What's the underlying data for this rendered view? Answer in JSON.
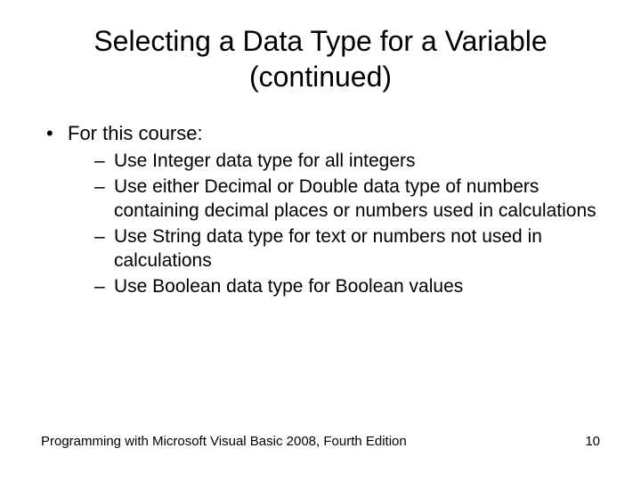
{
  "title_line1": "Selecting a Data Type for a Variable",
  "title_line2": "(continued)",
  "bullets": {
    "main": "For this course:",
    "sub": [
      "Use Integer data type for all integers",
      "Use either Decimal or Double data type of numbers containing decimal places or numbers used in calculations",
      "Use String data type for text or numbers not used in calculations",
      "Use Boolean data type for Boolean values"
    ]
  },
  "footer": {
    "book": "Programming with Microsoft Visual Basic 2008, Fourth Edition",
    "page": "10"
  }
}
